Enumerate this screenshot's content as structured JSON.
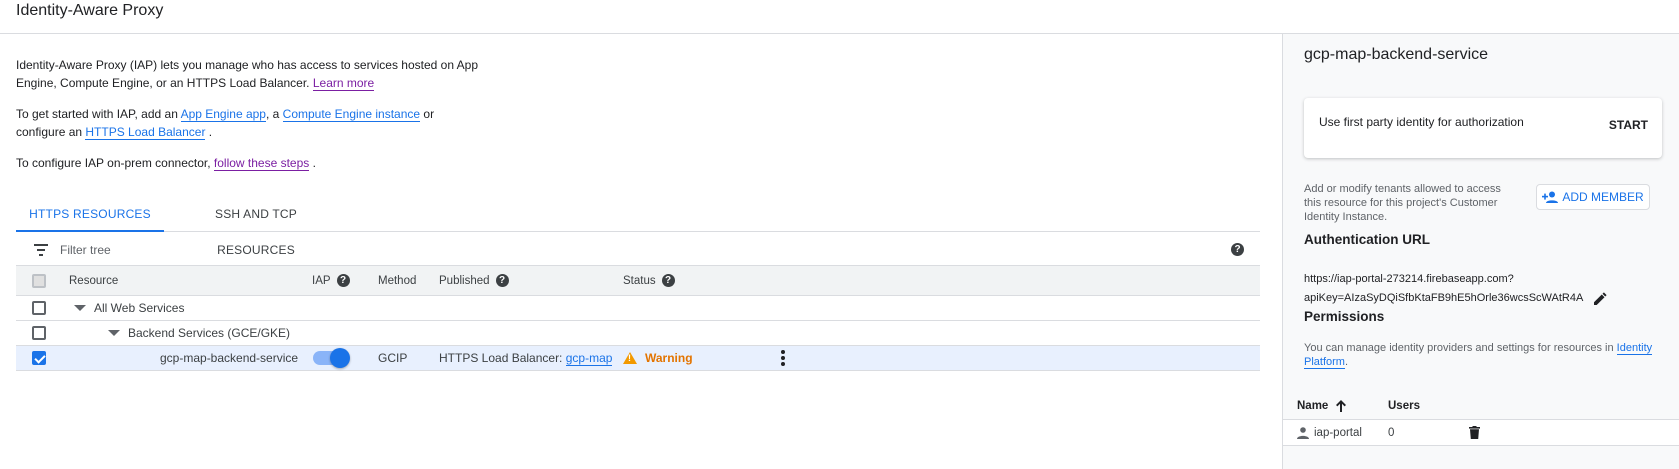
{
  "header": {
    "title": "Identity-Aware Proxy"
  },
  "intro": {
    "p1_text": "Identity-Aware Proxy (IAP) lets you manage who has access to services hosted on App Engine, Compute Engine, or an HTTPS Load Balancer. ",
    "p1_link": "Learn more",
    "p2_a": "To get started with IAP, add an ",
    "p2_link1": "App Engine app",
    "p2_b": ", a ",
    "p2_link2": "Compute Engine instance",
    "p2_c": " or configure an ",
    "p2_link3": "HTTPS Load Balancer",
    "p2_d": " .",
    "p3_a": "To configure IAP on-prem connector, ",
    "p3_link": "follow these steps",
    "p3_b": " ."
  },
  "tabs": [
    {
      "label": "HTTPS RESOURCES",
      "active": true
    },
    {
      "label": "SSH AND TCP RESOURCES",
      "active": false
    }
  ],
  "filter": {
    "placeholder": "Filter tree"
  },
  "table": {
    "columns": {
      "resource": "Resource",
      "iap": "IAP",
      "method": "Method",
      "published": "Published",
      "status": "Status"
    },
    "rows": [
      {
        "name": "All Web Services"
      },
      {
        "name": "Backend Services (GCE/GKE)"
      },
      {
        "name": "gcp-map-backend-service",
        "iap_enabled": true,
        "method": "GCIP",
        "published_prefix": "HTTPS Load Balancer: ",
        "published_link": "gcp-map",
        "status": "Warning"
      }
    ]
  },
  "panel": {
    "title": "gcp-map-backend-service",
    "card_text": "Use first party identity for authorization",
    "card_button": "START",
    "tenants_text": "Add or modify tenants allowed to access this resource for this project's Customer Identity Instance.",
    "add_member_label": "ADD MEMBER",
    "auth_url_title": "Authentication URL",
    "auth_url_line1": "https://iap-portal-273214.firebaseapp.com?",
    "auth_url_line2": "apiKey=AIzaSyDQiSfbKtaFB9hE5hOrle36wcsScWAtR4A",
    "permissions_title": "Permissions",
    "permissions_text": "You can manage identity providers and settings for resources in ",
    "permissions_link": "Identity Platform",
    "permissions_end": ".",
    "table": {
      "col_name": "Name",
      "col_users": "Users",
      "rows": [
        {
          "name": "iap-portal",
          "users": "0"
        }
      ]
    }
  },
  "colors": {
    "accent": "#1a73e8",
    "warning": "#e37400",
    "visited_link": "#7b1fa2"
  }
}
